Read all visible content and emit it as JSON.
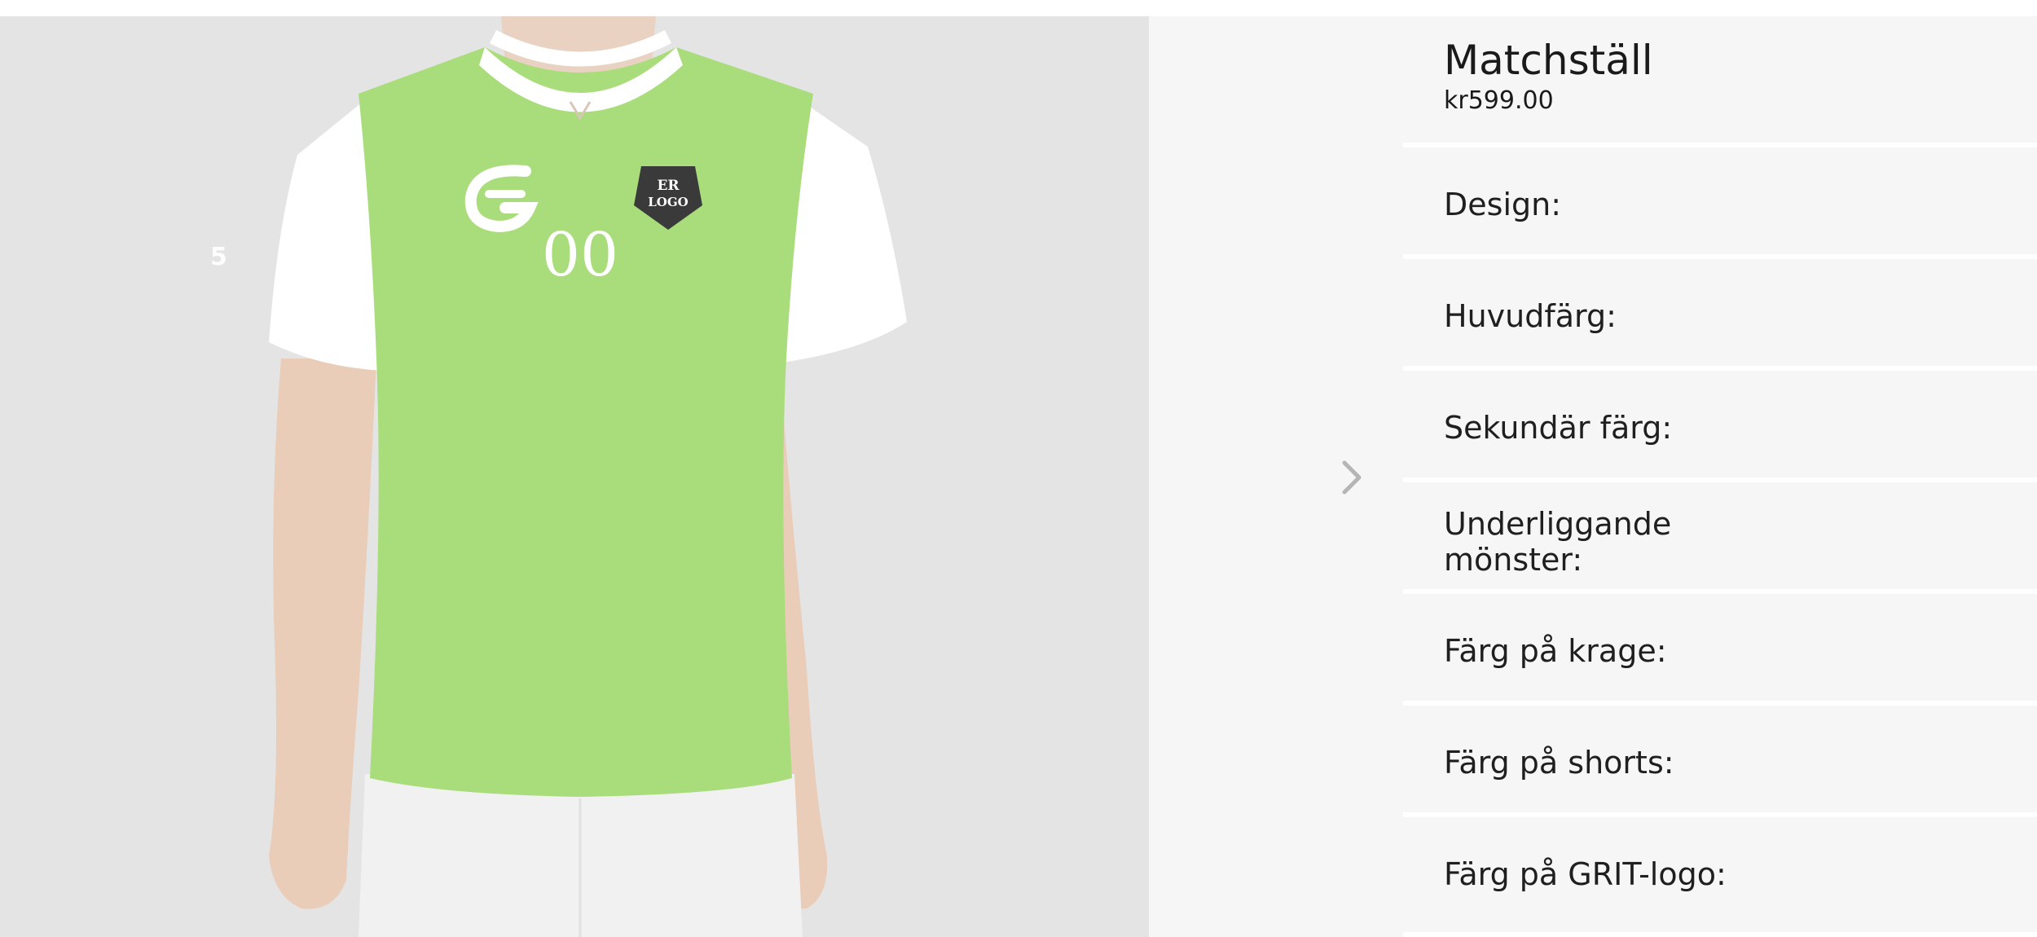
{
  "gallery": {
    "slide_index": "5",
    "next_icon": "chevron-right-icon",
    "jersey": {
      "number": "00",
      "brand_icon": "grit-g-logo-icon",
      "crest_text_line1": "ER",
      "crest_text_line2": "LOGO",
      "body_color": "#a9dc7a",
      "sleeve_color": "#ffffff",
      "collar_color": "#ffffff"
    }
  },
  "product": {
    "title": "Matchställ",
    "price": "kr599.00",
    "options": [
      {
        "label": "Design:"
      },
      {
        "label": "Huvudfärg:"
      },
      {
        "label": "Sekundär färg:"
      },
      {
        "label": "Underliggande mönster:"
      },
      {
        "label": "Färg på krage:"
      },
      {
        "label": "Färg på shorts:"
      },
      {
        "label": "Färg på GRIT-logo:"
      }
    ]
  },
  "colors": {
    "page_background": "#f6f6f6",
    "divider": "#ffffff",
    "jersey_green": "#a9dc7a",
    "crest_dark": "#3a3a3a",
    "arrow": "#b5b5b5"
  }
}
